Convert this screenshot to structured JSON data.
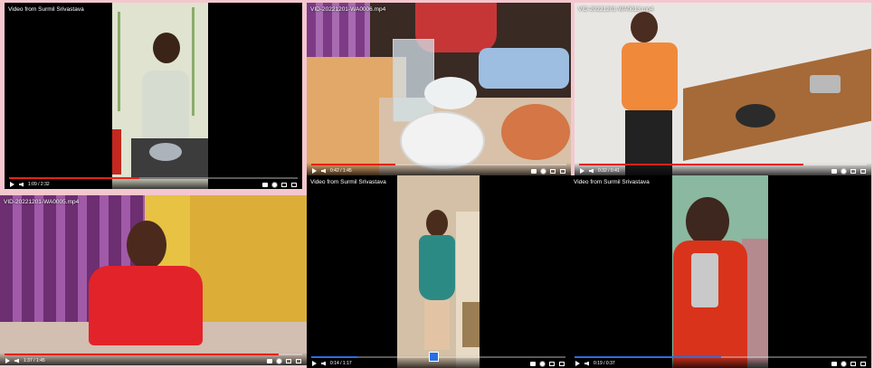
{
  "tiles": [
    {
      "title": "Video from Surmil Srivastava",
      "time": "1:09 / 2:32",
      "progress": 0.45
    },
    {
      "title": "VID-20221201-WA0006.mp4",
      "time": "0:42 / 1:45",
      "progress": 0.33
    },
    {
      "title": "VID-20221201-WA0013.mp4",
      "time": "0:32 / 0:41",
      "progress": 0.78
    },
    {
      "title": "VID-20221201-WA0005.mp4",
      "time": "1:37 / 1:45",
      "progress": 0.92
    },
    {
      "title": "Video from Surmil Srivastava",
      "time": "0:14 / 1:17",
      "progress": 0.18
    },
    {
      "title": "Video from Surmil Srivastava",
      "time": "0:19 / 0:37",
      "progress": 0.5
    }
  ]
}
